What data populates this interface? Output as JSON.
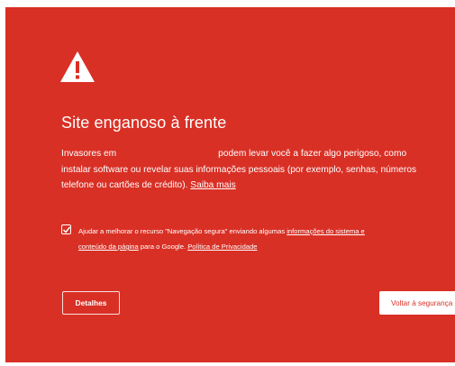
{
  "interstitial": {
    "title": "Site enganoso à frente",
    "body": {
      "line1_prefix": "Invasores em",
      "line1_suffix": "podem levar você a fazer algo perigoso, como",
      "line2": "instalar software ou revelar suas informações pessoais (por exemplo, senhas, números",
      "line3_prefix": "telefone ou cartões de crédito).",
      "learn_more_link": "Saiba mais"
    },
    "safe_browsing": {
      "checked": true,
      "text_prefix": "Ajudar a melhorar o recurso \"Navegação segura\" enviando algumas",
      "system_info_link_1": "informações do sistema e",
      "system_info_link_2": "conteúdo da página",
      "text_middle": "para o Google.",
      "privacy_link": "Política de Privacidade"
    },
    "details_button": "Detalhes",
    "back_button": "Voltar à segurança"
  },
  "colors": {
    "background": "#d93025",
    "text": "#ffffff"
  },
  "icons": {
    "warning": "warning-triangle-icon",
    "checkbox": "checkmark-icon"
  }
}
